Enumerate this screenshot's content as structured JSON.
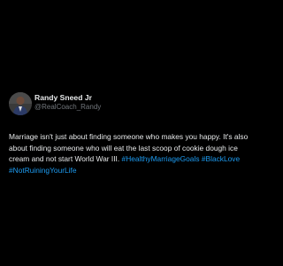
{
  "post": {
    "author": {
      "display_name": "Randy Sneed Jr",
      "handle": "@RealCoach_Randy",
      "avatar_icon": "profile-photo"
    },
    "text": "Marriage isn't just about finding someone who makes you happy. It's also about finding someone who will eat the last scoop of cookie dough ice cream and not start World War III.",
    "hashtags": [
      "#HealthyMarriageGoals",
      "#BlackLove",
      "#NotRuiningYourLife"
    ],
    "colors": {
      "background": "#000000",
      "text": "#e7e9ea",
      "handle": "#71767b",
      "link": "#1d9bf0"
    }
  }
}
